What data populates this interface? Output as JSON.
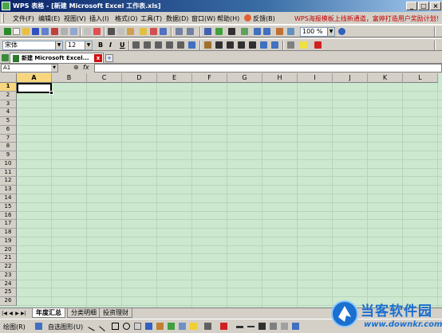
{
  "window": {
    "title": "WPS 表格 - [新建 Microsoft Excel 工作表.xls]",
    "minimize": "_",
    "maximize": "□",
    "close": "×"
  },
  "menu": {
    "items": [
      "文件(F)",
      "编辑(E)",
      "视图(V)",
      "插入(I)",
      "格式(O)",
      "工具(T)",
      "数据(D)",
      "窗口(W)",
      "帮助(H)"
    ],
    "feedback": "反馈(B)",
    "promo": "WPS海报模板上线新通道，富婷打造用户奖励计划!"
  },
  "standard_toolbar": {
    "zoom": "100 %"
  },
  "format_toolbar": {
    "font_name": "宋体",
    "font_size": "12",
    "bold": "B",
    "italic": "I",
    "underline": "U"
  },
  "doc_tab": {
    "label": "新建 Microsoft Excel...",
    "close": "x",
    "new": "+"
  },
  "formula_bar": {
    "name_box": "A1",
    "fx": "fx"
  },
  "grid": {
    "columns": [
      "A",
      "B",
      "C",
      "D",
      "E",
      "F",
      "G",
      "H",
      "I",
      "J",
      "K",
      "L"
    ],
    "rows": [
      "1",
      "2",
      "3",
      "4",
      "5",
      "6",
      "7",
      "8",
      "9",
      "10",
      "11",
      "12",
      "13",
      "14",
      "15",
      "16",
      "17",
      "18",
      "19",
      "20",
      "21",
      "22",
      "23",
      "24",
      "25",
      "26"
    ],
    "selected_cell": "A1"
  },
  "sheets": {
    "tabs": [
      "年度汇总",
      "分类明细",
      "投资理财"
    ],
    "active": "年度汇总"
  },
  "draw_toolbar": {
    "draw": "绘图(R)",
    "autoshapes": "自选图形(U)"
  },
  "watermark": {
    "brand": "当客软件园",
    "url": "www.downkr.com"
  }
}
